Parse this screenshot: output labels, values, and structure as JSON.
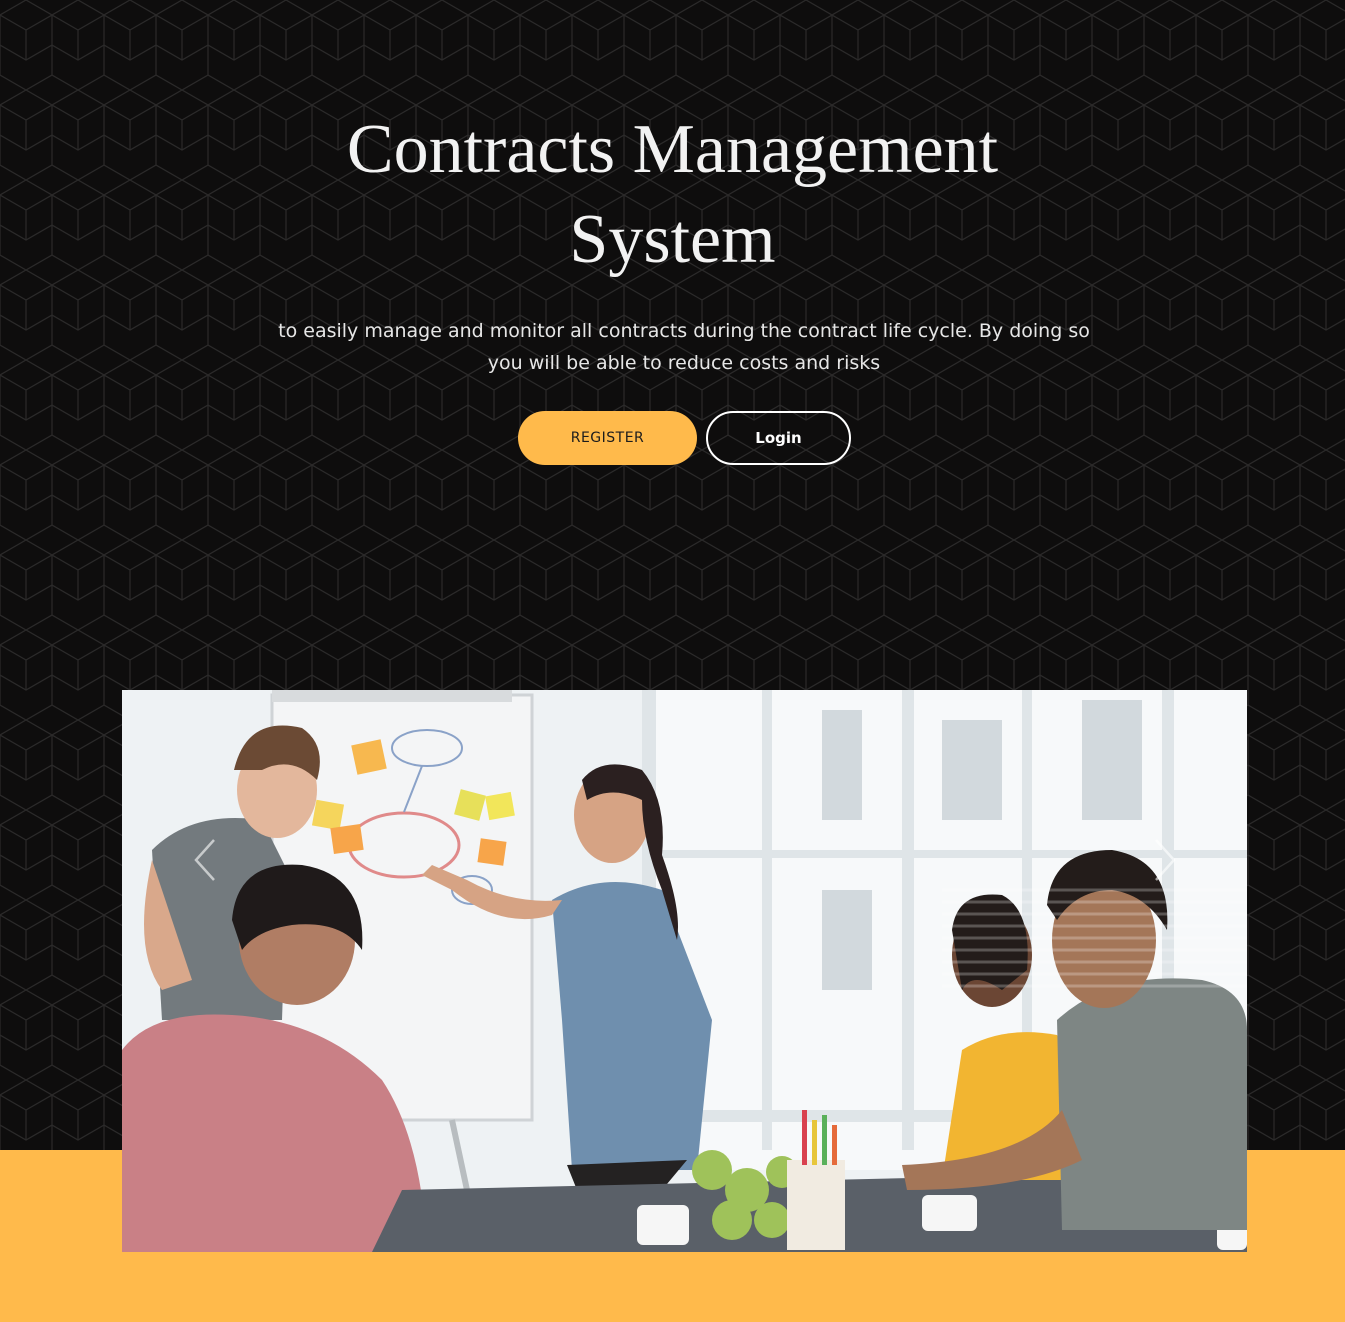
{
  "hero": {
    "title_line1": "Contracts Management",
    "title_line2": "System",
    "subtitle": "to easily manage and monitor all contracts during the contract life cycle. By doing so you will be able to reduce costs and risks",
    "register_label": "REGISTER",
    "login_label": "Login"
  },
  "carousel": {
    "prev_icon": "chevron-left-icon",
    "next_icon": "chevron-right-icon"
  },
  "colors": {
    "background": "#0e0d0d",
    "accent": "#ffba4b",
    "text_light": "#f2f2f2"
  }
}
